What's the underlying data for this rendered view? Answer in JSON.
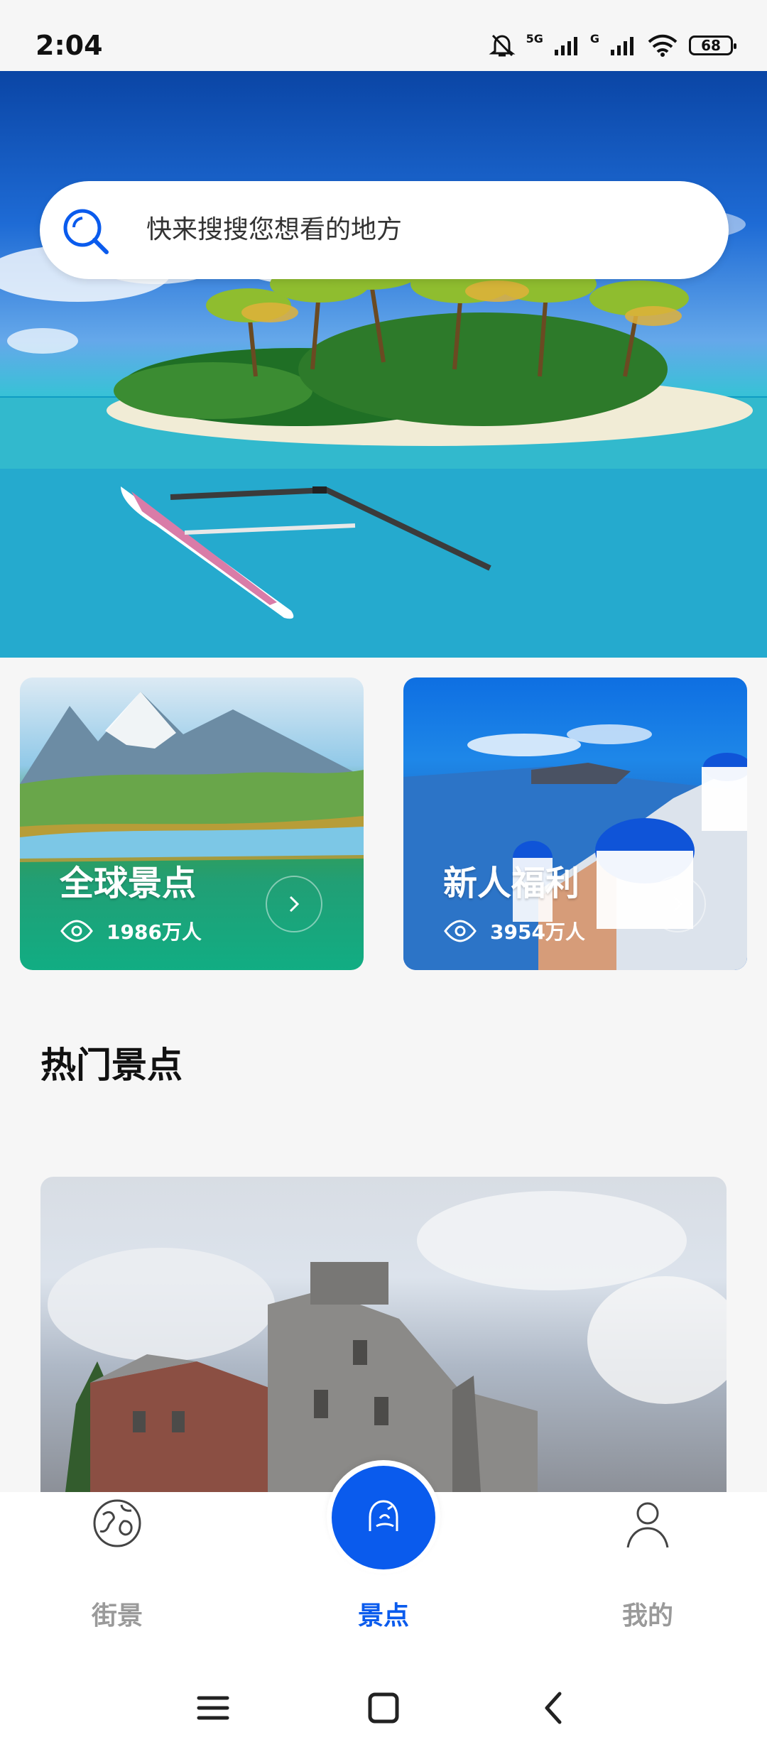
{
  "status": {
    "time": "2:04",
    "network_label_1": "5G",
    "network_label_2": "G",
    "battery": "68"
  },
  "search": {
    "placeholder": "快来搜搜您想看的地方"
  },
  "cards": [
    {
      "title": "全球景点",
      "views": "1986万人"
    },
    {
      "title": "新人福利",
      "views": "3954万人"
    }
  ],
  "section": {
    "title": "热门景点"
  },
  "tabs": [
    {
      "label": "街景",
      "icon": "globe-icon",
      "active": false
    },
    {
      "label": "景点",
      "icon": "mountain-icon",
      "active": true
    },
    {
      "label": "我的",
      "icon": "person-icon",
      "active": false
    }
  ],
  "colors": {
    "accent": "#0a5bed",
    "tab_inactive": "#9a9a9a",
    "background": "#f6f6f6"
  }
}
